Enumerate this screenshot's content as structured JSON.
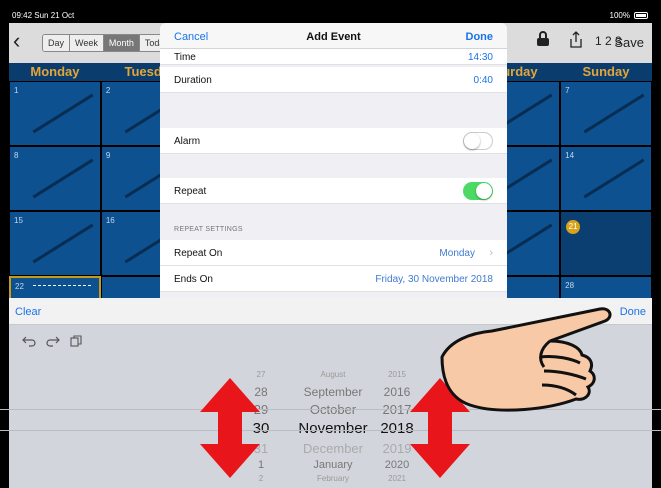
{
  "status": {
    "time": "09:42  Sun 21 Oct",
    "battery": "100%"
  },
  "toolbar": {
    "views": [
      "Day",
      "Week",
      "Month",
      "Toda"
    ],
    "active_view": "Month",
    "save_label": "Save",
    "sort_label": "1 2 3"
  },
  "calendar": {
    "days": [
      "Monday",
      "Tuesda",
      "",
      "",
      "",
      "aturday",
      "Sunday"
    ],
    "dates": [
      "1",
      "2",
      "7",
      "8",
      "9",
      "14",
      "15",
      "16",
      "21",
      "22",
      "28"
    ]
  },
  "modal": {
    "cancel_label": "Cancel",
    "title": "Add Event",
    "done_label": "Done",
    "time_label": "Time",
    "time_value": "14:30",
    "duration_label": "Duration",
    "duration_value": "0:40",
    "alarm_label": "Alarm",
    "alarm_on": false,
    "repeat_label": "Repeat",
    "repeat_on": true,
    "section_title": "REPEAT SETTINGS",
    "repeat_on_label": "Repeat On",
    "repeat_on_value": "Monday",
    "ends_on_label": "Ends On",
    "ends_on_value": "Friday, 30 November 2018"
  },
  "picker": {
    "clear_label": "Clear",
    "done_label": "Done",
    "days": [
      "27",
      "28",
      "29",
      "30",
      "31",
      "1",
      "2"
    ],
    "months": [
      "August",
      "September",
      "October",
      "November",
      "December",
      "January",
      "February"
    ],
    "years": [
      "2015",
      "2016",
      "2017",
      "2018",
      "2019",
      "2020",
      "2021"
    ],
    "selected": {
      "day": "30",
      "month": "November",
      "year": "2018"
    }
  },
  "colors": {
    "accent": "#1a73e8",
    "calendar_bg": "#0d5190",
    "day_header": "#e3a53a",
    "toggle_on": "#4cd964",
    "annotation_arrow": "#e8161b"
  },
  "icons": {
    "back": "chevron-left-icon",
    "lock": "lock-icon",
    "share": "share-icon",
    "undo": "undo-icon",
    "redo": "redo-icon",
    "copy": "copy-icon"
  }
}
